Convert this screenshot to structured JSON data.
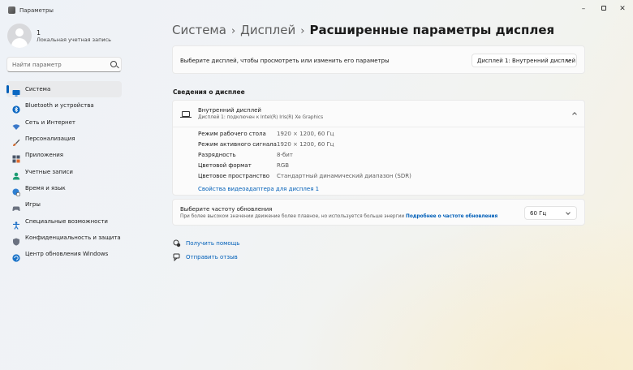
{
  "window": {
    "title": "Параметры"
  },
  "profile": {
    "name": "1",
    "account_type": "Локальная учетная запись"
  },
  "search": {
    "placeholder": "Найти параметр"
  },
  "nav": [
    {
      "id": "system",
      "label": "Система",
      "icon": "monitor-icon",
      "color": "#0a67c2",
      "active": true
    },
    {
      "id": "bluetooth",
      "label": "Bluetooth и устройства",
      "icon": "bluetooth-icon",
      "color": "#0a67c2"
    },
    {
      "id": "network",
      "label": "Сеть и Интернет",
      "icon": "wifi-icon",
      "color": "#3a78c9"
    },
    {
      "id": "personalization",
      "label": "Персонализация",
      "icon": "brush-icon",
      "color": "#d06c32"
    },
    {
      "id": "apps",
      "label": "Приложения",
      "icon": "apps-icon",
      "color": "#4a5568"
    },
    {
      "id": "accounts",
      "label": "Учетные записи",
      "icon": "person-icon",
      "color": "#1f9d74"
    },
    {
      "id": "time",
      "label": "Время и язык",
      "icon": "globe-clock-icon",
      "color": "#2f7fd1"
    },
    {
      "id": "gaming",
      "label": "Игры",
      "icon": "gamepad-icon",
      "color": "#6b7280"
    },
    {
      "id": "accessibility",
      "label": "Специальные возможности",
      "icon": "accessibility-icon",
      "color": "#1c6fc7"
    },
    {
      "id": "privacy",
      "label": "Конфиденциальность и защита",
      "icon": "shield-icon",
      "color": "#6b7280"
    },
    {
      "id": "update",
      "label": "Центр обновления Windows",
      "icon": "update-icon",
      "color": "#1a73c8"
    }
  ],
  "breadcrumb": {
    "level1": "Система",
    "level2": "Дисплей",
    "current": "Расширенные параметры дисплея",
    "separator": "›"
  },
  "select_display": {
    "label": "Выберите дисплей, чтобы просмотреть или изменить его параметры",
    "value": "Дисплей 1: Внутренний дисплей"
  },
  "display_info": {
    "section_title": "Сведения о дисплее",
    "title": "Внутренний дисплей",
    "subtitle": "Дисплей 1: подключен к Intel(R) Iris(R) Xe Graphics",
    "rows": [
      {
        "label": "Режим рабочего стола",
        "value": "1920 × 1200, 60 Гц"
      },
      {
        "label": "Режим активного сигнала",
        "value": "1920 × 1200, 60 Гц"
      },
      {
        "label": "Разрядность",
        "value": "8-бит"
      },
      {
        "label": "Цветовой формат",
        "value": "RGB"
      },
      {
        "label": "Цветовое пространство",
        "value": "Стандартный динамический диапазон (SDR)"
      }
    ],
    "adapter_link": "Свойства видеоадаптера для дисплея 1"
  },
  "refresh": {
    "title": "Выберите частоту обновления",
    "description": "При более высоком значении движение более плавное, но используется больше энергии",
    "more_link": "Подробнее о частоте обновления",
    "value": "60 Гц"
  },
  "help": {
    "get_help": "Получить помощь",
    "feedback": "Отправить отзыв"
  },
  "colors": {
    "accent": "#005fb8"
  }
}
